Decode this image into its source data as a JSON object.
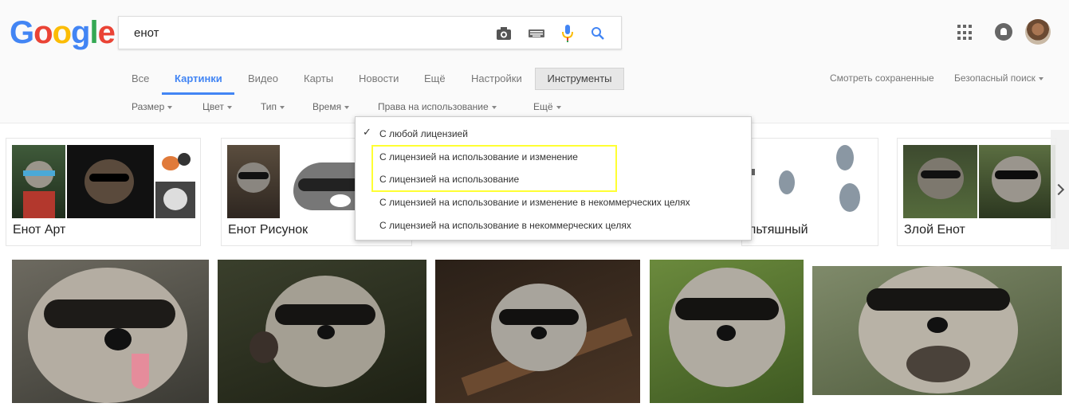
{
  "logo": {
    "letters": [
      "G",
      "o",
      "o",
      "g",
      "l",
      "e"
    ]
  },
  "search": {
    "query": "енот"
  },
  "icons": {
    "camera": "camera-icon",
    "keyboard": "keyboard-icon",
    "mic": "microphone-icon",
    "search": "search-icon",
    "apps": "apps-grid-icon",
    "notifications": "notifications-icon"
  },
  "tabs": [
    "Все",
    "Картинки",
    "Видео",
    "Карты",
    "Новости",
    "Ещё",
    "Настройки"
  ],
  "tools_label": "Инструменты",
  "header_links": {
    "saved": "Смотреть сохраненные",
    "safe_search": "Безопасный поиск"
  },
  "filters": [
    "Размер",
    "Цвет",
    "Тип",
    "Время",
    "Права на использование",
    "Ещё"
  ],
  "related_cards": [
    {
      "label": "Енот Арт"
    },
    {
      "label": "Енот Рисунок"
    },
    {
      "label": "льтяшный"
    },
    {
      "label": "Злой Енот"
    }
  ],
  "license_dropdown": {
    "items": [
      "С любой лицензией",
      "С лицензией на использование и изменение",
      "С лицензией на использование",
      "С лицензией на использование и изменение в некоммерческих целях",
      "С лицензией на использование в некоммерческих целях"
    ],
    "selected": "С любой лицензией"
  },
  "colors": {
    "accent_blue": "#4285f4",
    "highlight": "#ffff33",
    "mic_blue": "#4285f4",
    "mic_red": "#ea4335"
  }
}
